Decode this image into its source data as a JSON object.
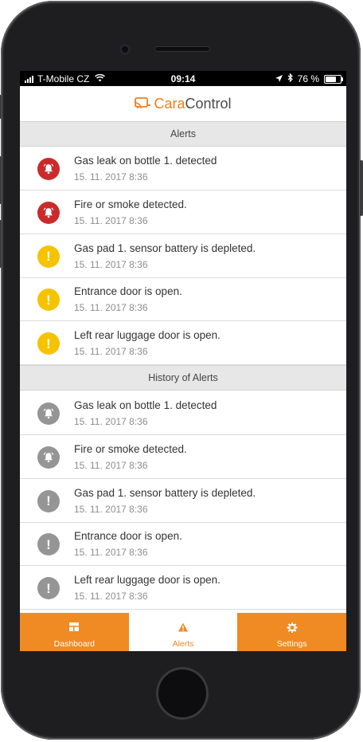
{
  "statusbar": {
    "carrier": "T-Mobile CZ",
    "time": "09:14",
    "battery": "76 %",
    "battery_level": 0.76
  },
  "header": {
    "logo_part1": "Cara",
    "logo_part2": "Control"
  },
  "alerts": {
    "heading": "Alerts",
    "items": [
      {
        "title": "Gas leak on bottle 1. detected",
        "date": "15. 11. 2017  8:36",
        "severity": "red",
        "icon": "bell-icon"
      },
      {
        "title": "Fire or smoke detected.",
        "date": "15. 11. 2017  8:36",
        "severity": "red",
        "icon": "bell-icon"
      },
      {
        "title": "Gas pad 1. sensor battery is depleted.",
        "date": "15. 11. 2017  8:36",
        "severity": "yellow",
        "icon": "exclamation-icon"
      },
      {
        "title": "Entrance door is open.",
        "date": "15. 11. 2017  8:36",
        "severity": "yellow",
        "icon": "exclamation-icon"
      },
      {
        "title": "Left rear luggage door is open.",
        "date": "15. 11. 2017  8:36",
        "severity": "yellow",
        "icon": "exclamation-icon"
      }
    ]
  },
  "history": {
    "heading": "History of Alerts",
    "items": [
      {
        "title": "Gas leak on bottle 1. detected",
        "date": "15. 11. 2017  8:36",
        "severity": "gray",
        "icon": "bell-icon"
      },
      {
        "title": "Fire or smoke detected.",
        "date": "15. 11. 2017  8:36",
        "severity": "gray",
        "icon": "bell-icon"
      },
      {
        "title": "Gas pad 1. sensor battery is depleted.",
        "date": "15. 11. 2017  8:36",
        "severity": "gray",
        "icon": "exclamation-icon"
      },
      {
        "title": "Entrance door is open.",
        "date": "15. 11. 2017  8:36",
        "severity": "gray",
        "icon": "exclamation-icon"
      },
      {
        "title": "Left rear luggage door is open.",
        "date": "15. 11. 2017  8:36",
        "severity": "gray",
        "icon": "exclamation-icon"
      }
    ]
  },
  "tabs": [
    {
      "label": "Dashboard",
      "icon": "dashboard-icon",
      "active": false
    },
    {
      "label": "Alerts",
      "icon": "warning-icon",
      "active": true
    },
    {
      "label": "Settings",
      "icon": "gear-icon",
      "active": false
    }
  ],
  "colors": {
    "accent": "#f08a23",
    "red": "#cc2a2a",
    "yellow": "#f6c300",
    "gray": "#959595"
  }
}
